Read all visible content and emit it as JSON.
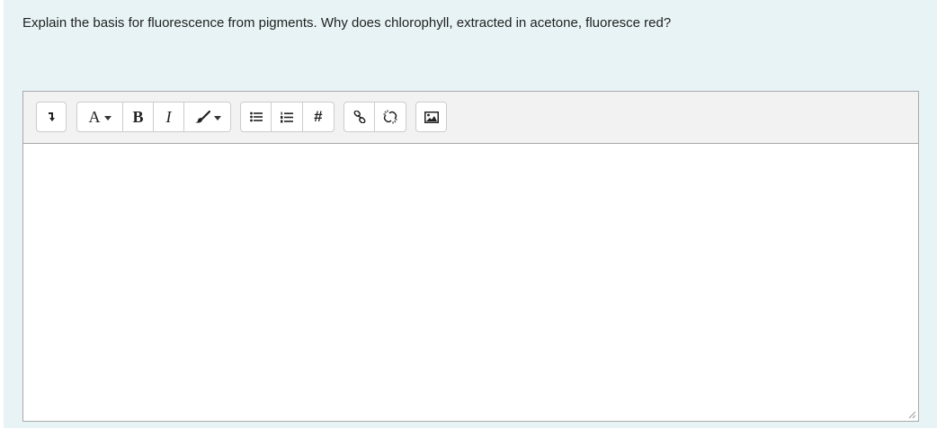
{
  "question": {
    "text": "Explain the basis for fluorescence from pigments. Why does chlorophyll, extracted in acetone, fluoresce red?"
  },
  "toolbar": {
    "toggle_icon": "arrow-down-icon",
    "font_style_label": "A",
    "bold_label": "B",
    "italic_label": "I",
    "style_icon": "paintbrush-icon",
    "unordered_list_icon": "bullet-list-icon",
    "ordered_list_icon": "numbered-list-icon",
    "hash_label": "#",
    "link_icon": "link-icon",
    "unlink_icon": "unlink-icon",
    "image_icon": "image-icon"
  },
  "editor": {
    "content": ""
  },
  "colors": {
    "panel_background": "#e7f3f5",
    "toolbar_background": "#f2f2f2",
    "border": "#a9a9a9"
  }
}
